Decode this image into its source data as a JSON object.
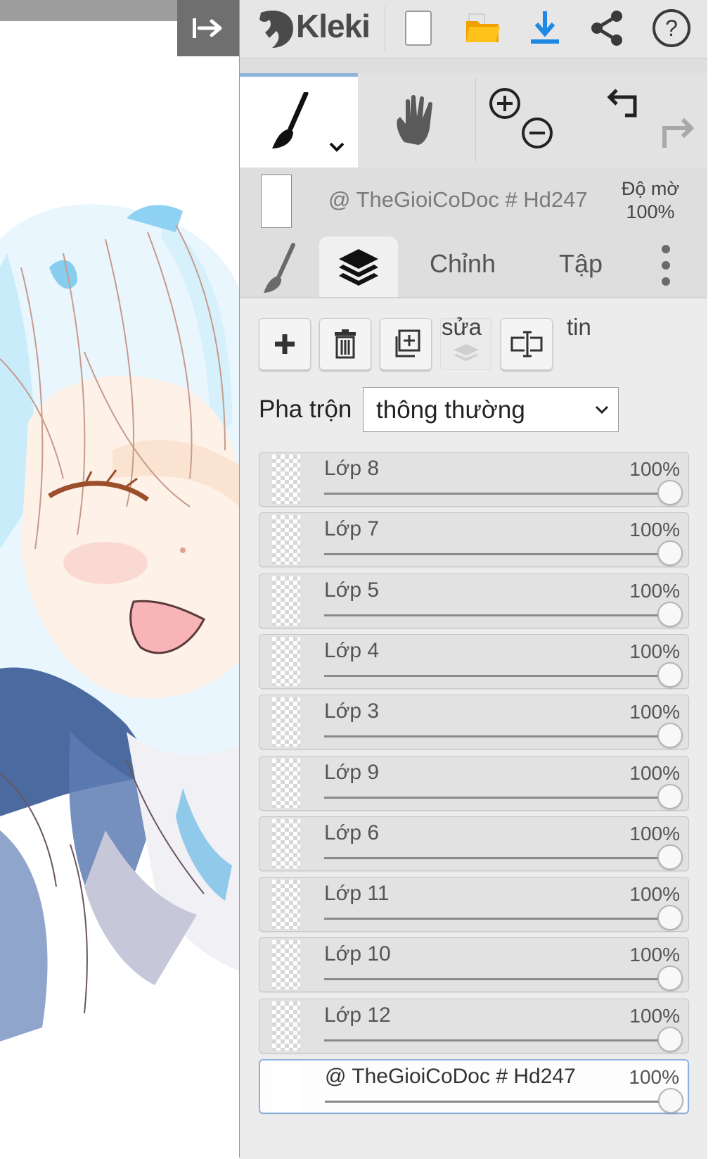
{
  "app": {
    "name": "Kleki"
  },
  "header": {
    "icons": [
      "kleki-logo-icon",
      "new-file-icon",
      "open-folder-icon",
      "download-icon",
      "share-icon",
      "help-icon"
    ]
  },
  "tools": {
    "active": "brush",
    "items": [
      "brush-icon",
      "hand-icon",
      "zoom-in-icon",
      "zoom-out-icon",
      "undo-icon",
      "redo-icon"
    ]
  },
  "color_row": {
    "primary_color": "#ffffff",
    "label": "@ TheGioiCoDoc # Hd247",
    "opacity_label": "Độ mờ",
    "opacity_value": "100%"
  },
  "tabs": {
    "brush_icon": "brush-icon",
    "layers_icon": "layers-icon",
    "adjust": "Chỉnh",
    "file": "Tập",
    "file_suffix": "tin",
    "adjust_suffix": "sửa",
    "more_icon": "more-vertical-icon"
  },
  "layer_actions": [
    "add-layer-icon",
    "delete-layer-icon",
    "duplicate-layer-icon",
    "merge-layer-icon",
    "rename-layer-icon"
  ],
  "blend": {
    "label": "Pha trộn",
    "value": "thông thường"
  },
  "layers": [
    {
      "name": "Lớp 8",
      "opacity": "100%",
      "level": 1.0,
      "selected": false
    },
    {
      "name": "Lớp 7",
      "opacity": "100%",
      "level": 1.0,
      "selected": false
    },
    {
      "name": "Lớp 5",
      "opacity": "100%",
      "level": 1.0,
      "selected": false
    },
    {
      "name": "Lớp 4",
      "opacity": "100%",
      "level": 1.0,
      "selected": false
    },
    {
      "name": "Lớp 3",
      "opacity": "100%",
      "level": 1.0,
      "selected": false
    },
    {
      "name": "Lớp 9",
      "opacity": "100%",
      "level": 1.0,
      "selected": false
    },
    {
      "name": "Lớp 6",
      "opacity": "100%",
      "level": 1.0,
      "selected": false
    },
    {
      "name": "Lớp 11",
      "opacity": "100%",
      "level": 1.0,
      "selected": false
    },
    {
      "name": "Lớp 10",
      "opacity": "100%",
      "level": 1.0,
      "selected": false
    },
    {
      "name": "Lớp 12",
      "opacity": "100%",
      "level": 1.0,
      "selected": false
    },
    {
      "name": "@ TheGioiCoDoc # Hd247",
      "opacity": "100%",
      "level": 1.0,
      "selected": true
    }
  ],
  "colors": {
    "accent": "#8fb3da",
    "download": "#1e88e5",
    "folder": "#f4b400"
  }
}
